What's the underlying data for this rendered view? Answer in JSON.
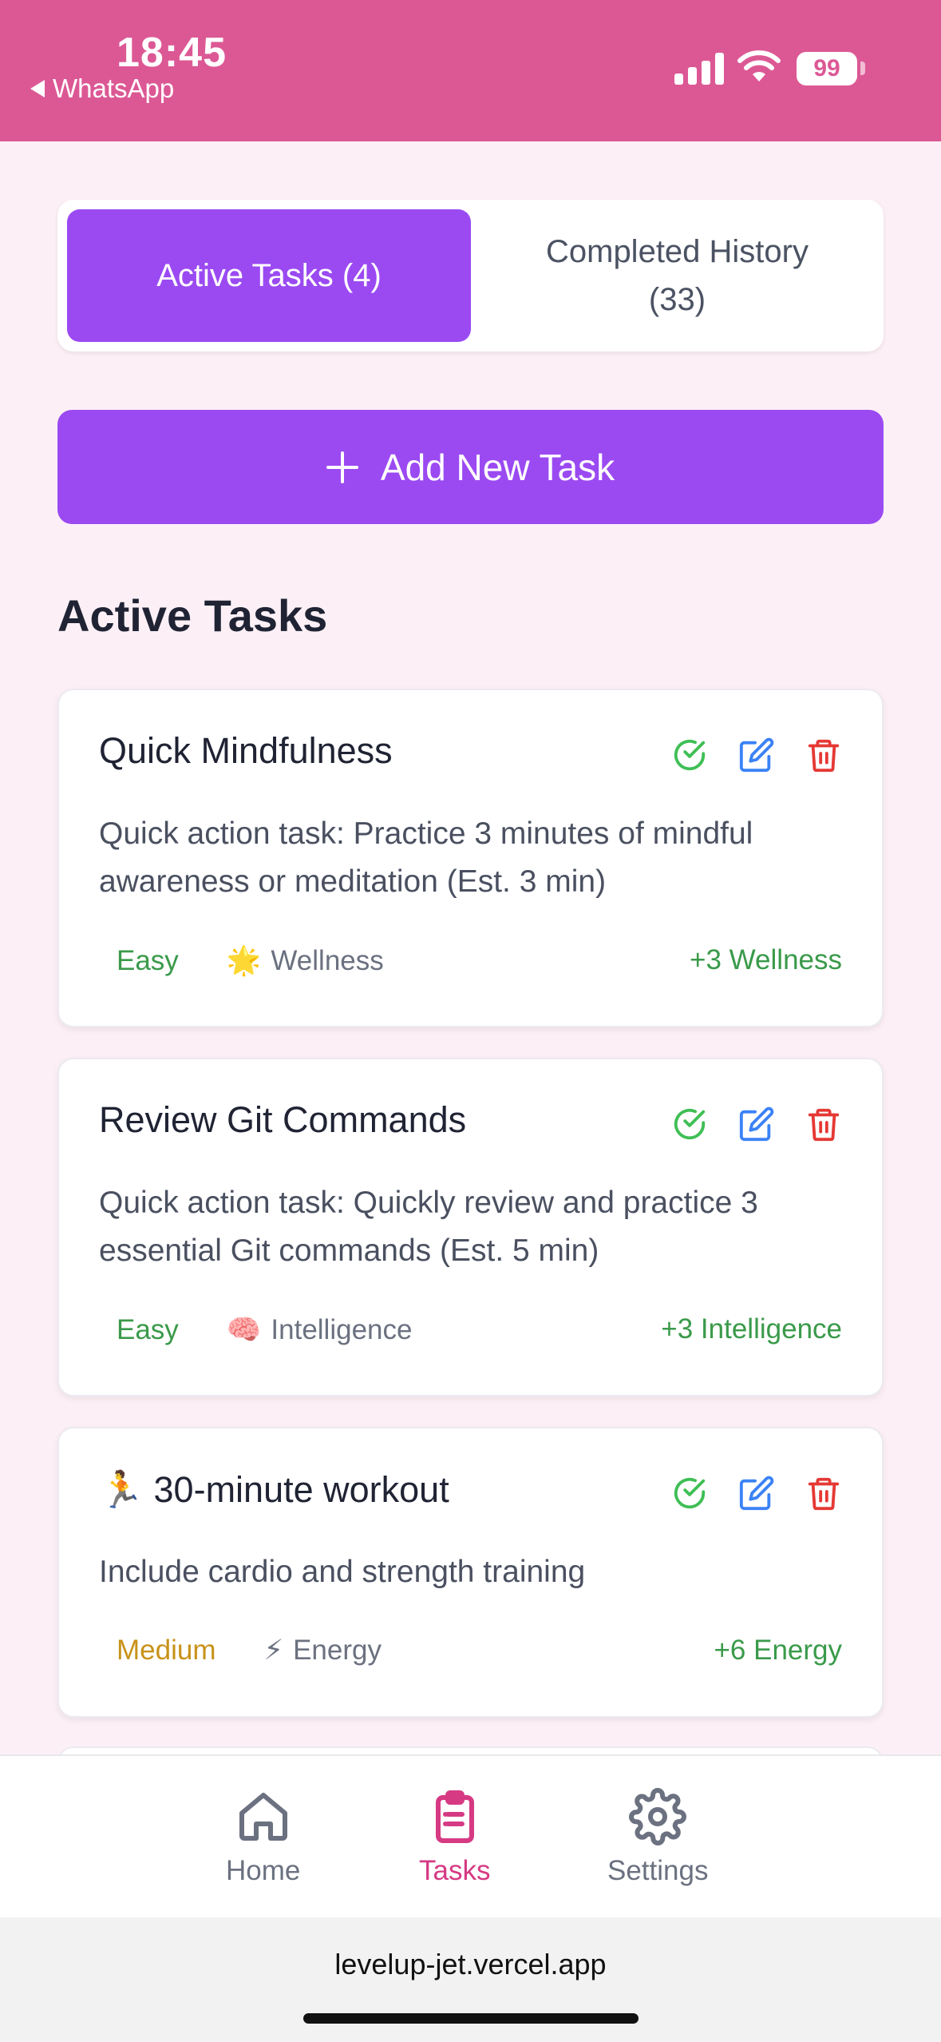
{
  "status_bar": {
    "time": "18:45",
    "back_app": "WhatsApp",
    "battery": "99",
    "background_color": "#dc5895"
  },
  "tabs": {
    "active_label": "Active Tasks (4)",
    "inactive_label": "Completed History (33)"
  },
  "add_button": {
    "label": "Add New Task",
    "icon": "plus-icon"
  },
  "section_title": "Active Tasks",
  "tasks": [
    {
      "title": "Quick Mindfulness",
      "description": "Quick action task: Practice 3 minutes of mindful awareness or meditation (Est. 3 min)",
      "difficulty": "Easy",
      "category_emoji": "🌟",
      "category": "Wellness",
      "reward": "+3 Wellness"
    },
    {
      "title": "Review Git Commands",
      "description": "Quick action task: Quickly review and practice 3 essential Git commands (Est. 5 min)",
      "difficulty": "Easy",
      "category_emoji": "🧠",
      "category": "Intelligence",
      "reward": "+3 Intelligence"
    },
    {
      "title": "🏃 30-minute workout",
      "description": "Include cardio and strength training",
      "difficulty": "Medium",
      "category_emoji": "⚡",
      "category": "Energy",
      "reward": "+6 Energy"
    }
  ],
  "bottom_nav": {
    "home": "Home",
    "tasks": "Tasks",
    "settings": "Settings"
  },
  "browser": {
    "url": "levelup-jet.vercel.app"
  },
  "colors": {
    "accent_purple": "#9b4af2",
    "nav_active": "#d63a83",
    "success_green": "#3a9a4a",
    "edit_blue": "#3b82f6",
    "delete_red": "#e53935",
    "medium_amber": "#c8921a"
  }
}
